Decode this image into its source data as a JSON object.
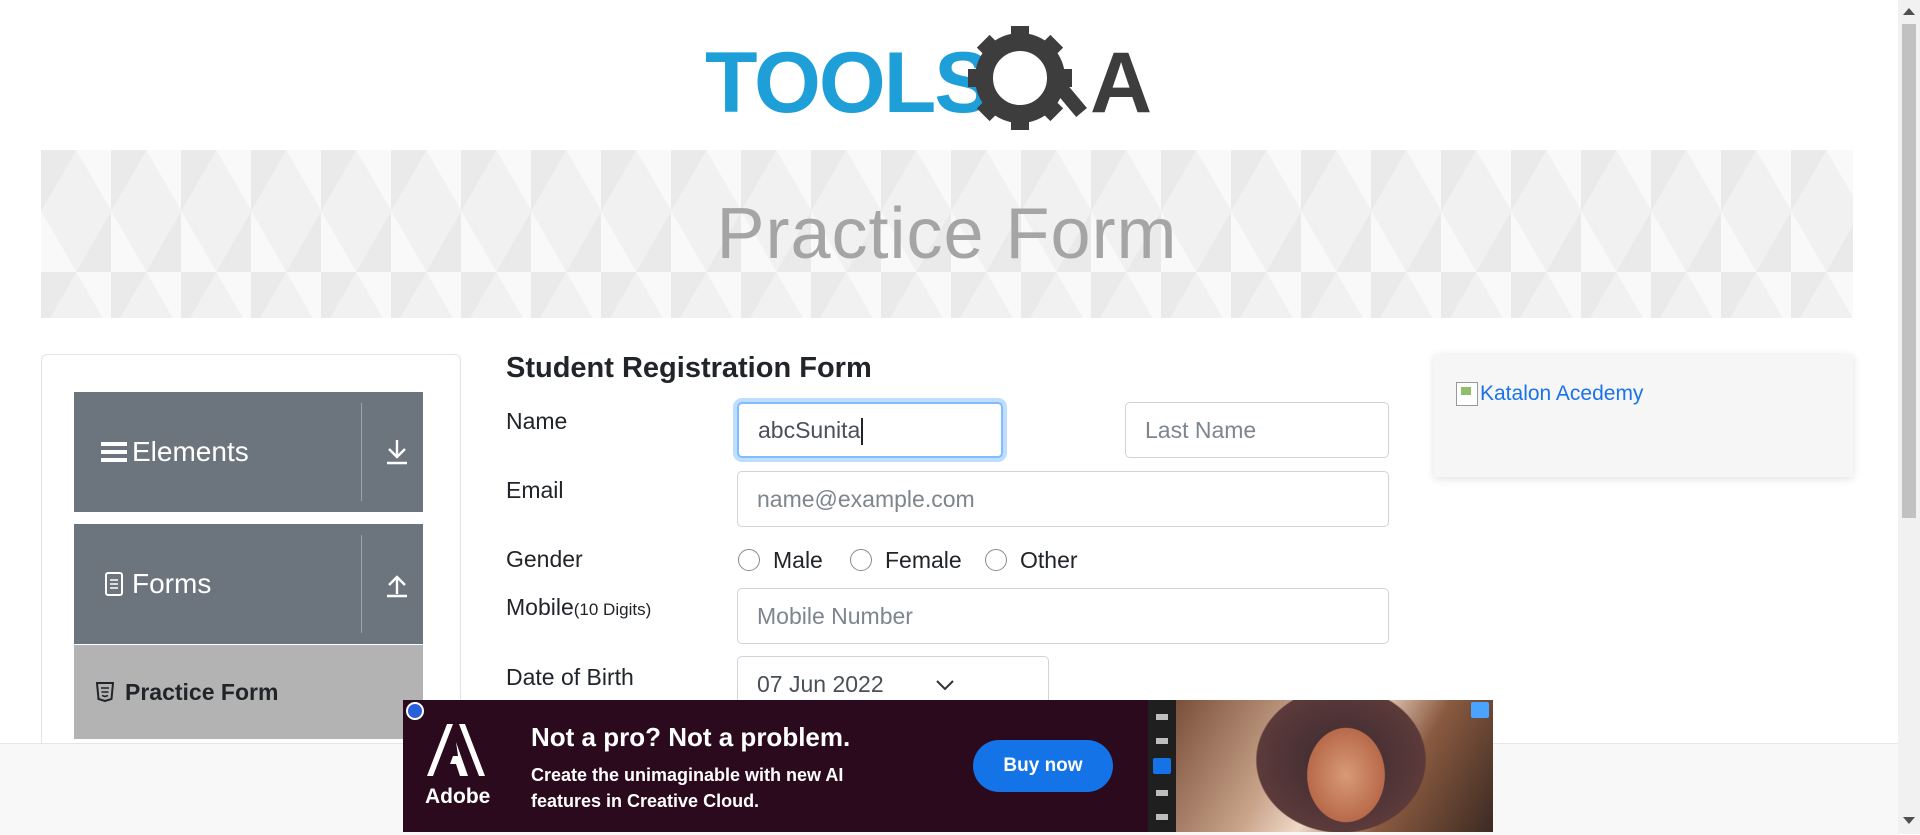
{
  "logo": {
    "text_primary": "TOOLS",
    "text_secondary": "QA",
    "color_primary": "#1e9fd8",
    "color_secondary": "#3d3d3d"
  },
  "banner": {
    "title": "Practice Form"
  },
  "sidebar": {
    "groups": [
      {
        "label": "Elements",
        "icon": "hamburger-icon",
        "toggle_icon": "download-arrow-icon"
      },
      {
        "label": "Forms",
        "icon": "document-icon",
        "toggle_icon": "upload-arrow-icon"
      }
    ],
    "active_item": {
      "label": "Practice Form",
      "icon": "html5-icon"
    }
  },
  "form": {
    "title": "Student Registration Form",
    "name_label": "Name",
    "first_name_value": "abcSunita",
    "last_name_placeholder": "Last Name",
    "email_label": "Email",
    "email_placeholder": "name@example.com",
    "gender_label": "Gender",
    "gender_options": [
      "Male",
      "Female",
      "Other"
    ],
    "mobile_label": "Mobile",
    "mobile_hint": "(10 Digits)",
    "mobile_placeholder": "Mobile Number",
    "dob_label": "Date of Birth",
    "dob_value": "07 Jun 2022"
  },
  "right_ad": {
    "alt_text": "Katalon Acedemy"
  },
  "bottom_ad": {
    "brand": "Adobe",
    "headline": "Not a pro? Not a problem.",
    "subtext": "Create the unimaginable with new AI features in Creative Cloud.",
    "cta": "Buy now",
    "cta_color": "#1473e6",
    "background_color": "#2a0a1c"
  },
  "colors": {
    "sidebar_group": "#6c757d",
    "sidebar_active": "#b3b3b3",
    "focus_border": "#80bdff"
  }
}
